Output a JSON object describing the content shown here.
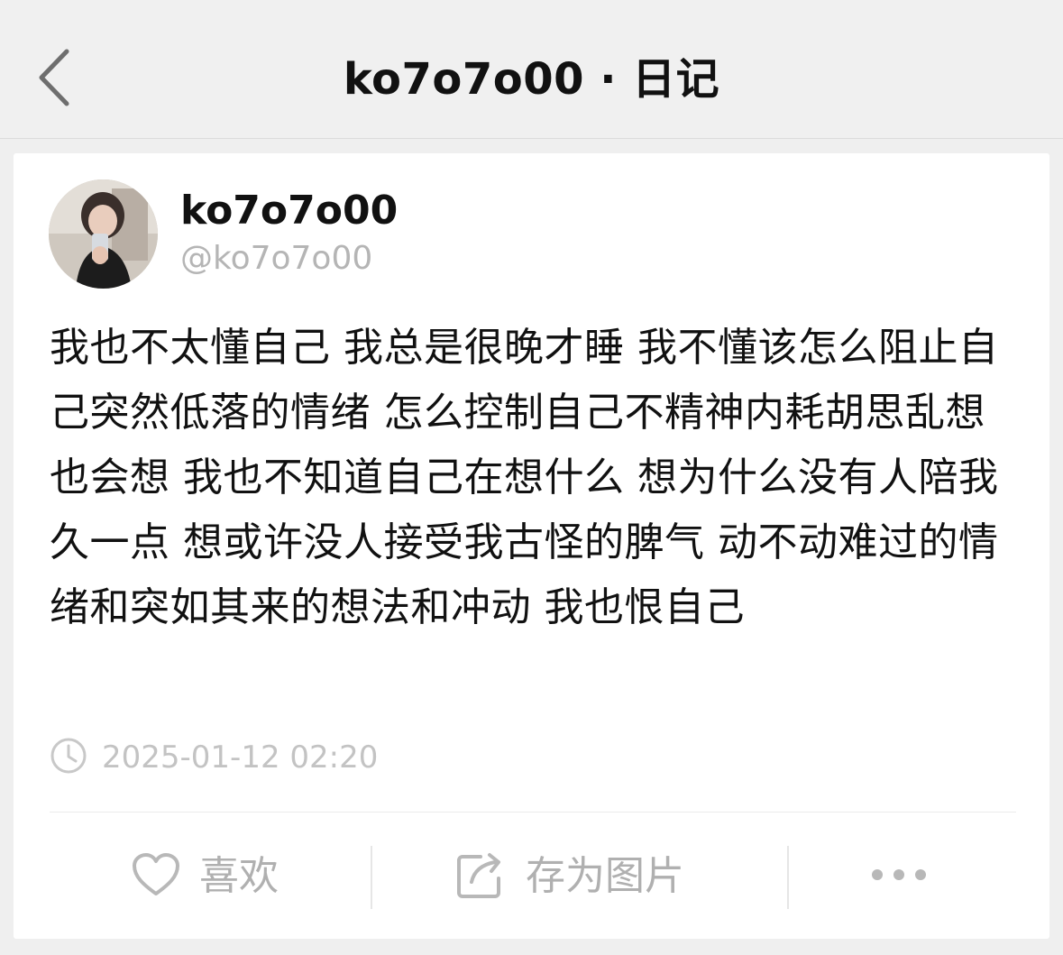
{
  "header": {
    "title": "ko7o7o00 · 日记",
    "back_icon": "chevron-left-icon"
  },
  "post": {
    "author": {
      "name": "ko7o7o00",
      "handle": "@ko7o7o00"
    },
    "text": "我也不太懂自己 我总是很晚才睡 我不懂该怎么阻止自己突然低落的情绪 怎么控制自己不精神内耗胡思乱想也会想 我也不知道自己在想什么 想为什么没有人陪我久一点 想或许没人接受我古怪的脾气 动不动难过的情绪和突如其来的想法和冲动 我也恨自己",
    "timestamp": "2025-01-12 02:20"
  },
  "actions": {
    "like_label": "喜欢",
    "save_image_label": "存为图片"
  },
  "colors": {
    "background": "#efefef",
    "card": "#ffffff",
    "muted_text": "#b0b0b0",
    "primary_text": "#111111"
  }
}
